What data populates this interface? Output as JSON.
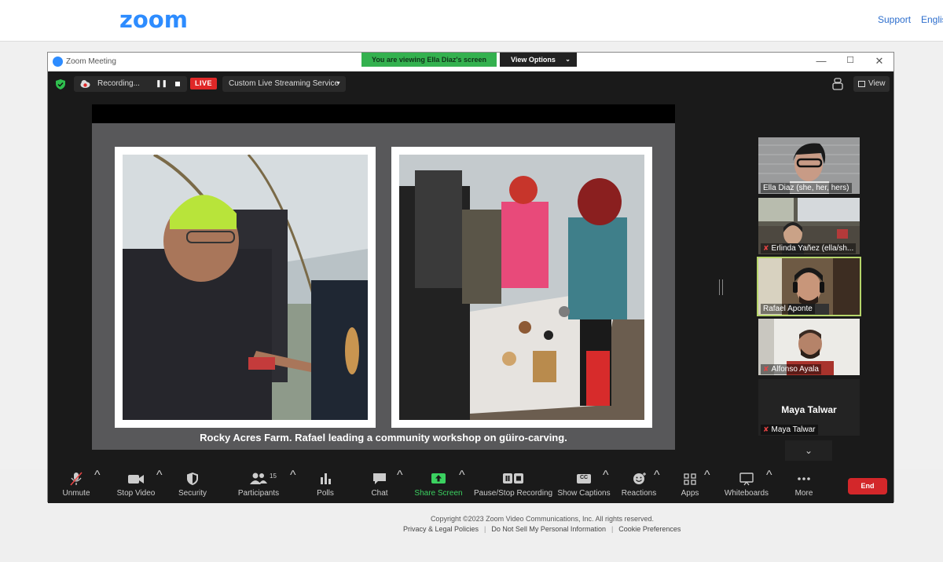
{
  "site": {
    "logo": "zoom",
    "links": [
      "Support",
      "Englis"
    ]
  },
  "window": {
    "title": "Zoom Meeting",
    "viewing_banner": "You are viewing Ella Diaz's screen",
    "view_options": "View Options",
    "minimize": "—",
    "maximize": "☐",
    "close": "✕"
  },
  "topbar": {
    "recording_text": "Recording...",
    "pause_symbol": "❚❚",
    "live_badge": "LIVE",
    "streaming_service": "Custom Live Streaming Service",
    "view_label": "View"
  },
  "shared_content": {
    "caption": "Rocky Acres Farm. Rafael leading a community workshop on güiro-carving."
  },
  "participants": [
    {
      "name": "Ella Diaz (she, her, hers)",
      "muted": false,
      "active": false
    },
    {
      "name": "Erlinda Yañez (ella/sh...",
      "muted": true,
      "active": false
    },
    {
      "name": "Rafael Aponte",
      "muted": false,
      "active": true
    },
    {
      "name": "Alfonso Ayala",
      "muted": true,
      "active": false
    },
    {
      "name": "Maya Talwar",
      "muted": true,
      "active": false,
      "display_name": "Maya Talwar"
    }
  ],
  "toolbar": {
    "unmute": "Unmute",
    "stop_video": "Stop Video",
    "security": "Security",
    "participants": "Participants",
    "participant_count": "15",
    "polls": "Polls",
    "chat": "Chat",
    "share_screen": "Share Screen",
    "pause_stop_recording": "Pause/Stop Recording",
    "show_captions": "Show Captions",
    "cc": "CC",
    "reactions": "Reactions",
    "apps": "Apps",
    "whiteboards": "Whiteboards",
    "more": "More",
    "end": "End"
  },
  "footer": {
    "copyright": "Copyright ©2023 Zoom Video Communications, Inc. All rights reserved.",
    "privacy": "Privacy & Legal Policies",
    "do_not_sell": "Do Not Sell My Personal Information",
    "cookie": "Cookie Preferences"
  },
  "colors": {
    "zoom_blue": "#2d8cff",
    "live_red": "#e02828",
    "end_red": "#d3272a",
    "share_green": "#3bd160",
    "active_speaker": "#b6d56a"
  }
}
